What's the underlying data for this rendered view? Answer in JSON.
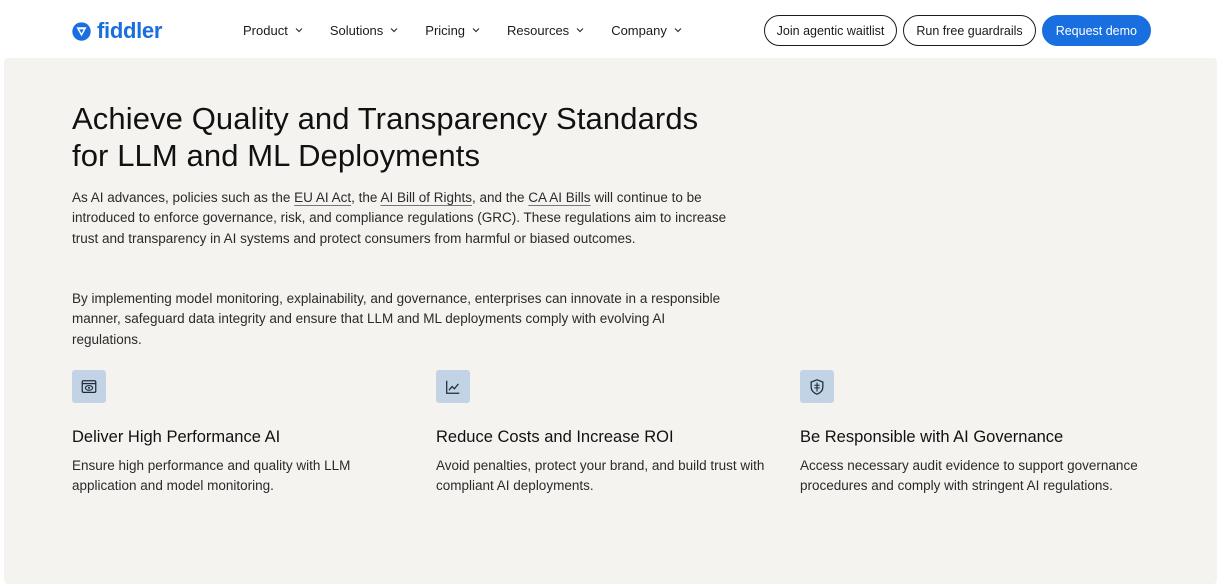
{
  "brand": {
    "name": "fiddler",
    "color": "#1a6fe0",
    "logo_icon": "fiddler-logo-icon"
  },
  "nav": {
    "items": [
      {
        "label": "Product"
      },
      {
        "label": "Solutions"
      },
      {
        "label": "Pricing"
      },
      {
        "label": "Resources"
      },
      {
        "label": "Company"
      }
    ],
    "buttons": {
      "agentic": "Join agentic waitlist",
      "guardrails": "Run free guardrails",
      "demo": "Request demo"
    }
  },
  "hero": {
    "title_line1": "Achieve Quality and Transparency Standards",
    "title_line2": "for LLM and ML Deployments",
    "p1": {
      "t1": "As AI advances, policies such as the ",
      "link1": "EU AI Act",
      "t2": ", the ",
      "link2": "AI Bill of Rights",
      "t3": ", and the ",
      "link3": "CA AI Bills",
      "t4": " will continue to be introduced to enforce governance, risk, and compliance regulations (GRC). These regulations aim to increase trust and transparency in AI systems and protect consumers from harmful or biased outcomes."
    },
    "p2": "By implementing model monitoring, explainability, and governance, enterprises can innovate in a responsible manner, safeguard data integrity and ensure that LLM and ML deployments comply with evolving AI regulations."
  },
  "features": [
    {
      "icon": "monitor-eye-icon",
      "title": "Deliver High Performance AI",
      "desc": "Ensure high performance and quality with LLM application and model monitoring."
    },
    {
      "icon": "trend-chart-icon",
      "title": "Reduce Costs and Increase ROI",
      "desc": "Avoid penalties, protect your brand, and build trust with compliant AI deployments."
    },
    {
      "icon": "shield-icon",
      "title": "Be Responsible with AI Governance",
      "desc": "Access necessary audit evidence to support governance procedures and comply with stringent AI regulations."
    }
  ],
  "colors": {
    "panel_bg": "#f4f3ef",
    "icon_tile": "#c3d3e6",
    "accent": "#1a6fe0"
  }
}
